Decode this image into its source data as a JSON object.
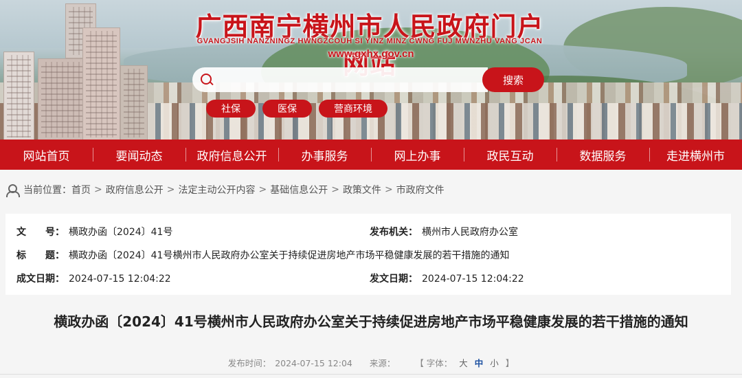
{
  "header": {
    "title": "广西南宁横州市人民政府门户网站",
    "subtitle": "GVANGJSIH NANZNINGZ HWNGZCOUH SI YINZ MINZ CWNG FUJ MWNZHU VANG JCAN",
    "url": "www.gxhx.gov.cn"
  },
  "search": {
    "placeholder": "",
    "button_label": "搜索"
  },
  "quick_tags": [
    "社保",
    "医保",
    "营商环境"
  ],
  "nav": [
    "网站首页",
    "要闻动态",
    "政府信息公开",
    "办事服务",
    "网上办事",
    "政民互动",
    "数据服务",
    "走进横州市"
  ],
  "breadcrumb": {
    "prefix": "当前位置：",
    "items": [
      "首页",
      "政府信息公开",
      "法定主动公开内容",
      "基础信息公开",
      "政策文件",
      "市政府文件"
    ]
  },
  "doc_info": {
    "doc_no_label": "文　　号：",
    "doc_no": "横政办函〔2024〕41号",
    "issuer_label": "发布机关：",
    "issuer": "横州市人民政府办公室",
    "title_label": "标　　题：",
    "title": "横政办函〔2024〕41号横州市人民政府办公室关于持续促进房地产市场平稳健康发展的若干措施的通知",
    "created_label": "成文日期：",
    "created": "2024-07-15 12:04:22",
    "published_label": "发文日期：",
    "published": "2024-07-15 12:04:22"
  },
  "article": {
    "title": "横政办函〔2024〕41号横州市人民政府办公室关于持续促进房地产市场平稳健康发展的若干措施的通知",
    "publish_time_label": "发布时间：",
    "publish_time": "2024-07-15 12:04",
    "source_label": "来源：",
    "font_label": "【 字体：",
    "font_large": "大",
    "font_medium": "中",
    "font_small": "小",
    "font_close": "】"
  },
  "colors": {
    "brand_red": "#c8141a",
    "active_link": "#1a4fa0"
  }
}
